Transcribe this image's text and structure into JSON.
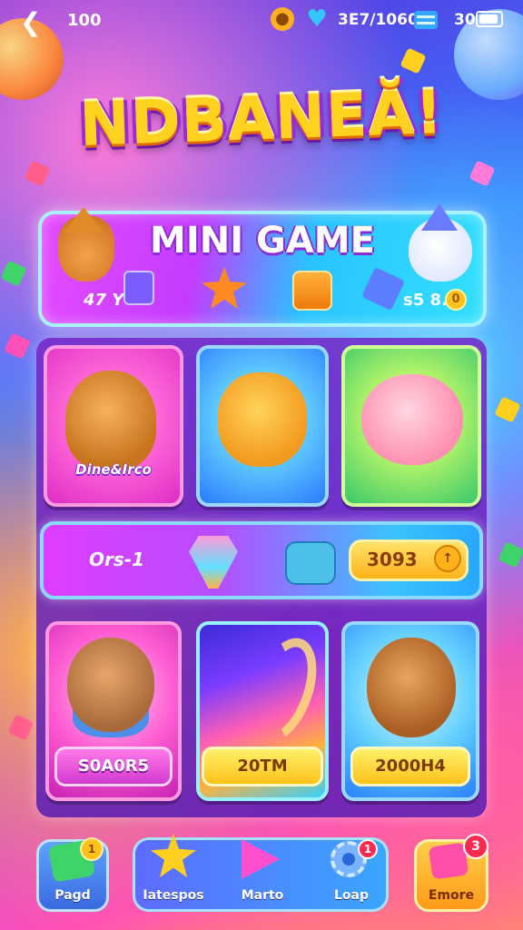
{
  "status_bar": {
    "back_icon": "chevron-left-icon",
    "level": "100",
    "coin_icon": "coin-icon",
    "gem_icon": "heart-gem-icon",
    "resources": "3E7/1060",
    "menu_icon": "menu-icon",
    "battery_value": "30",
    "battery_icon": "battery-icon"
  },
  "game_title": "NDBANEĂ!",
  "banner": {
    "title": "MINI GAME",
    "left_value": "47 Y",
    "right_value": "s5 8.",
    "coin_symbol": "0"
  },
  "top_tiles": [
    {
      "label": "Dine&Irco"
    },
    {
      "label": ""
    },
    {
      "label": ""
    }
  ],
  "middle_bar": {
    "label": "Ors-1",
    "pill_value": "3093",
    "coin_symbol": "↑"
  },
  "bottom_tiles": [
    {
      "button_label": "S0A0R5"
    },
    {
      "button_label": "20TM"
    },
    {
      "button_label": "2000H4"
    }
  ],
  "nav": {
    "items": [
      {
        "label": "Pagd",
        "icon": "gem-icon",
        "coin_symbol": "1"
      },
      {
        "label": "Iatespos",
        "icon": "star-icon"
      },
      {
        "label": "Marto",
        "icon": "play-icon"
      },
      {
        "label": "Loap",
        "icon": "gear-icon",
        "badge": "1"
      },
      {
        "label": "Emore",
        "icon": "more-icon",
        "badge": "3"
      }
    ]
  },
  "colors": {
    "accent_yellow": "#ffd21f",
    "accent_pink": "#ff4fd0",
    "accent_blue": "#3aa6ff",
    "badge_red": "#ff2a4f"
  }
}
